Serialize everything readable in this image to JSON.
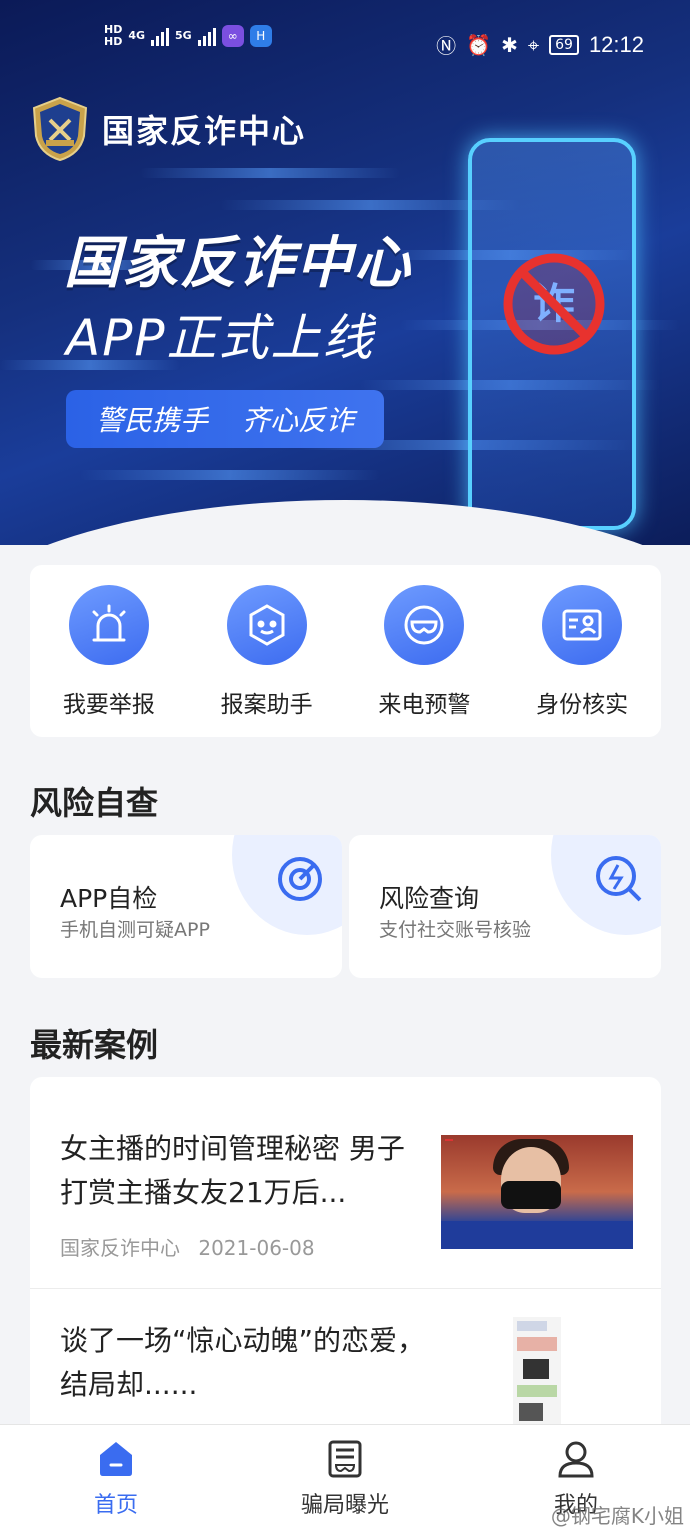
{
  "status_bar": {
    "hd1": "HD",
    "hd2": "HD",
    "net1": "4G",
    "net2": "5G",
    "battery": "69",
    "time": "12:12"
  },
  "banner": {
    "brand_name": "国家反诈中心",
    "hero_title": "国家反诈中心",
    "hero_subtitle": "APP正式上线",
    "slogan_1": "警民携手",
    "slogan_2": "齐心反诈",
    "phone_glyph": "诈"
  },
  "actions": [
    {
      "label": "我要举报",
      "icon": "alarm-light-icon"
    },
    {
      "label": "报案助手",
      "icon": "robot-face-icon"
    },
    {
      "label": "来电预警",
      "icon": "mask-icon"
    },
    {
      "label": "身份核实",
      "icon": "id-card-icon"
    }
  ],
  "risk_section": {
    "title": "风险自查",
    "cards": [
      {
        "title": "APP自检",
        "subtitle": "手机自测可疑APP",
        "icon": "target-scan-icon"
      },
      {
        "title": "风险查询",
        "subtitle": "支付社交账号核验",
        "icon": "lightning-search-icon"
      }
    ]
  },
  "cases_section": {
    "title": "最新案例",
    "items": [
      {
        "title": "女主播的时间管理秘密 男子打赏主播女友21万后...",
        "source": "国家反诈中心",
        "date": "2021-06-08"
      },
      {
        "title": "谈了一场“惊心动魄”的恋爱，结局却......"
      }
    ]
  },
  "tabbar": {
    "tabs": [
      {
        "label": "首页",
        "icon": "home-icon",
        "active": true
      },
      {
        "label": "骗局曝光",
        "icon": "exposure-icon",
        "active": false
      },
      {
        "label": "我的",
        "icon": "user-icon",
        "active": false
      }
    ]
  },
  "watermark": "@钢宅腐K小姐",
  "colors": {
    "accent": "#3a6cf0",
    "banner_dark": "#0b1a57",
    "background": "#f3f4f7"
  }
}
